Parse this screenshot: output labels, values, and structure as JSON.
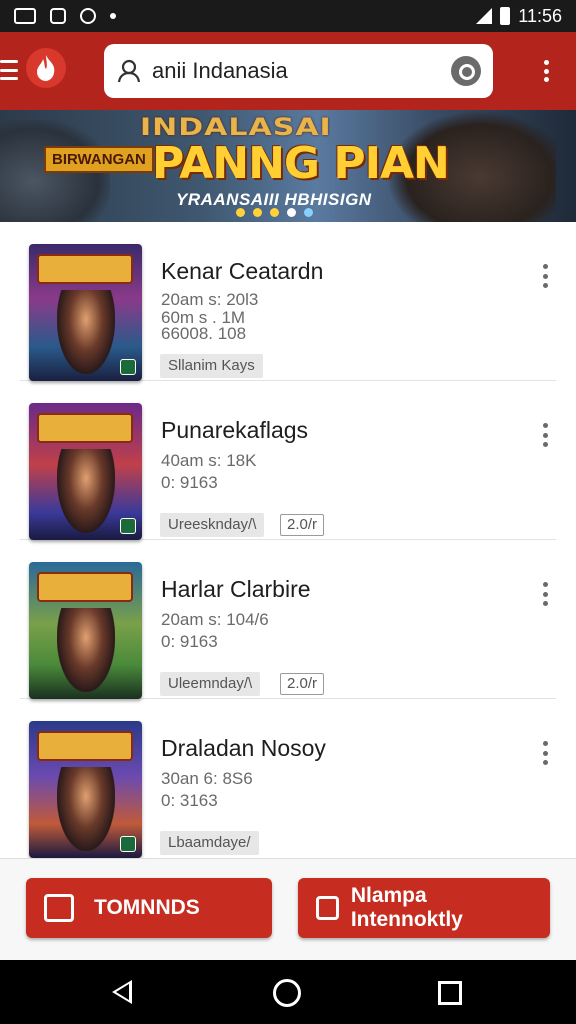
{
  "status_bar": {
    "time": "11:56"
  },
  "search": {
    "query": "anii  Indanasia"
  },
  "banner": {
    "title_top": "INDALASAI",
    "title": "PANNG PIAN",
    "subtitle": "YRAANSAIII HBHISIGN",
    "tag": "BIRWANGAN"
  },
  "list": {
    "items": [
      {
        "title": "Kenar Ceatardn",
        "meta1": "20am s: 20l3",
        "meta2": "60m  s . 1M",
        "meta3": "66008. 108",
        "tag": "Sllanim Kays",
        "tag2": ""
      },
      {
        "title": "Punarekaflags",
        "meta1": "40am s: 18K",
        "meta2": "0: 9163",
        "meta3": "",
        "tag": "Ureesknday/\\",
        "tag2": "2.0/r"
      },
      {
        "title": "Harlar Clarbire",
        "meta1": "20am s: 104/6",
        "meta2": "0: 9163",
        "meta3": "",
        "tag": "Uleemnday/\\",
        "tag2": "2.0/r"
      },
      {
        "title": "Draladan Nosoy",
        "meta1": "30an 6: 8S6",
        "meta2": "0: 3163",
        "meta3": "",
        "tag": "Lbaamdaye/",
        "tag2": ""
      }
    ]
  },
  "actions": {
    "left_label": "TOMNNDS",
    "right_label": "Nlampa Intennoktly"
  },
  "colors": {
    "app_bar": "#b3251c",
    "action_button": "#c62d20",
    "banner_title": "#ffcf33"
  },
  "icons": {
    "menu": "menu-icon",
    "logo": "flame-logo-icon",
    "search": "search-icon",
    "overflow": "overflow-icon",
    "back": "back-icon",
    "home": "home-icon",
    "recent": "recent-apps-icon"
  }
}
